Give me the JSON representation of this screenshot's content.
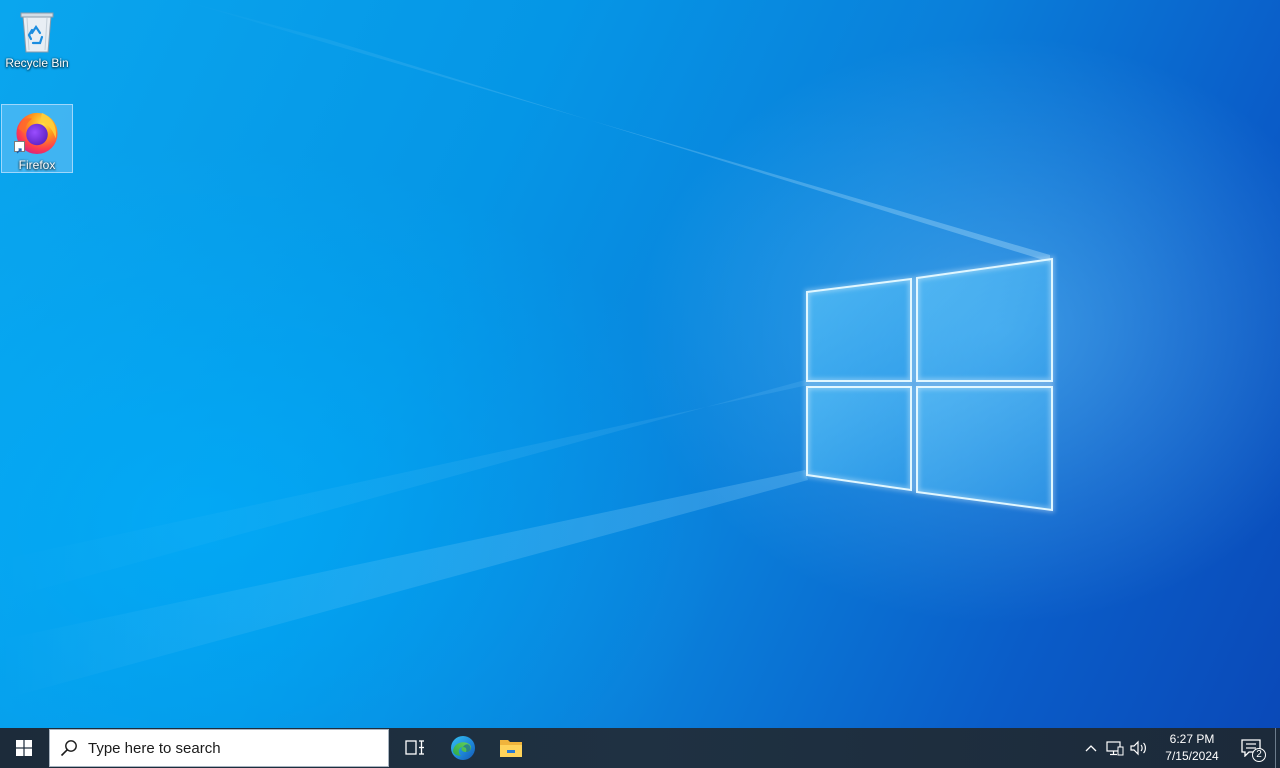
{
  "desktop": {
    "icons": [
      {
        "label": "Recycle Bin",
        "icon": "recycle-bin-icon"
      },
      {
        "label": "Firefox",
        "icon": "firefox-icon",
        "selected": true,
        "shortcut": true
      }
    ],
    "wallpaper": "windows-10-hero",
    "colors": {
      "primary": "#0a8fe3",
      "dark": "#0a49b8",
      "light": "#48c8ff"
    }
  },
  "taskbar": {
    "start_icon": "windows-start-icon",
    "search": {
      "placeholder": "Type here to search",
      "icon": "search-icon"
    },
    "apps": [
      {
        "name": "task-view",
        "icon": "task-view-icon"
      },
      {
        "name": "edge",
        "icon": "edge-icon"
      },
      {
        "name": "file-explorer",
        "icon": "folder-icon"
      }
    ],
    "tray": {
      "icons": [
        "chevron-up-icon",
        "network-icon",
        "volume-icon"
      ],
      "time": "6:27 PM",
      "date": "7/15/2024",
      "notifications": "2"
    }
  }
}
